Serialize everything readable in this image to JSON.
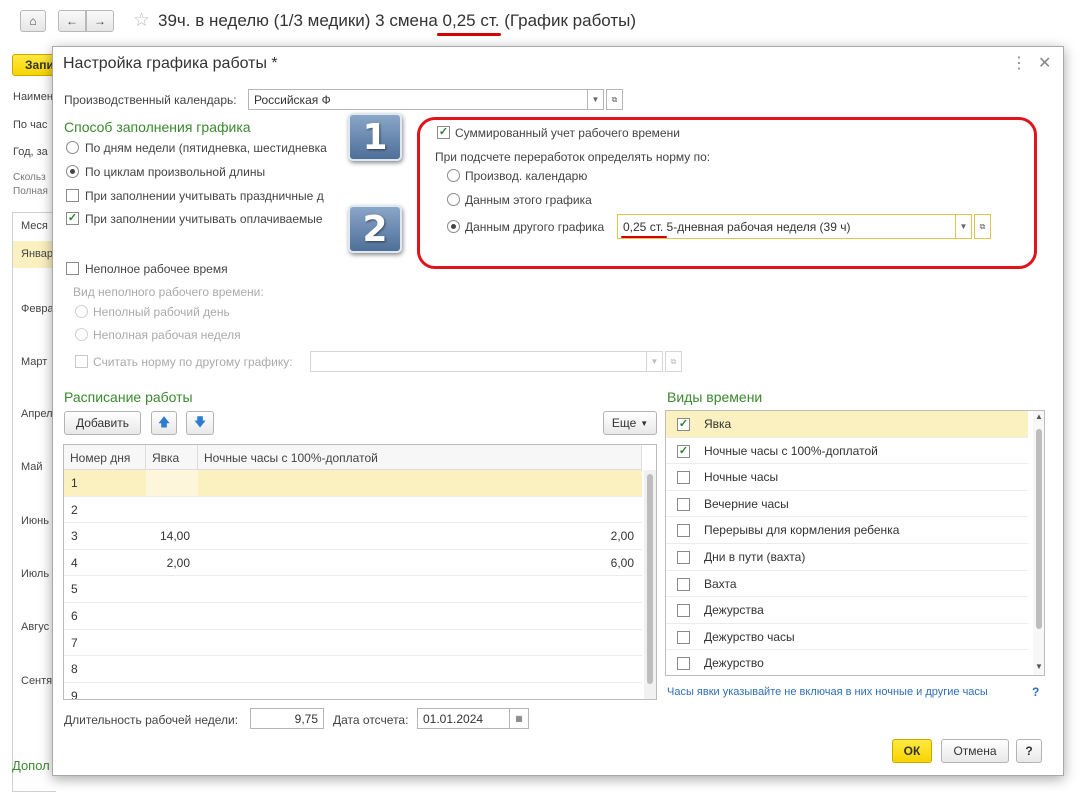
{
  "background": {
    "title": "39ч. в неделю (1/3 медики) 3 смена 0,25 ст. (График работы)",
    "home_icon": "home-icon",
    "back_icon": "arrow-left-icon",
    "forward_icon": "arrow-right-icon",
    "star_icon": "star-icon",
    "write_button": "Запи",
    "side_labels": [
      "Наимен",
      "По час",
      "Год, за",
      "Скольз",
      "Полная"
    ],
    "months_header": "Меся",
    "months": [
      "Январ",
      "Февра",
      "Март",
      "Апрел",
      "Май",
      "Июнь",
      "Июль",
      "Авгус",
      "Сентя"
    ],
    "bottom_label": "Допол"
  },
  "dialog": {
    "title": "Настройка графика работы *",
    "calendar_label": "Производственный календарь:",
    "calendar_value": "Российская Ф",
    "fill_method": {
      "heading": "Способ заполнения графика",
      "option_weekdays": "По дням недели (пятидневка, шестидневка",
      "option_cycles": "По циклам произвольной длины",
      "check_holidays": "При заполнении учитывать праздничные д",
      "check_paid": "При заполнении учитывать оплачиваемые"
    },
    "summed": {
      "check_label": "Суммированный учет рабочего времени",
      "norm_label": "При подсчете переработок определять норму по:",
      "option_calendar": "Производ. календарю",
      "option_this": "Данным этого графика",
      "option_other": "Данным другого графика",
      "other_value": "0,25 ст. 5-дневная рабочая неделя (39 ч)"
    },
    "part_time": {
      "check_label": "Неполное рабочее время",
      "kind_label": "Вид неполного рабочего времени:",
      "option_day": "Неполный рабочий день",
      "option_week": "Неполная рабочая неделя",
      "norm_check": "Считать норму по другому графику:"
    },
    "schedule": {
      "heading": "Расписание работы",
      "add_button": "Добавить",
      "more_button": "Еще",
      "columns": [
        "Номер дня",
        "Явка",
        "Ночные часы с 100%-доплатой"
      ],
      "rows": [
        {
          "day": "1",
          "presence": "",
          "night": ""
        },
        {
          "day": "2",
          "presence": "",
          "night": ""
        },
        {
          "day": "3",
          "presence": "14,00",
          "night": "2,00"
        },
        {
          "day": "4",
          "presence": "2,00",
          "night": "6,00"
        },
        {
          "day": "5",
          "presence": "",
          "night": ""
        },
        {
          "day": "6",
          "presence": "",
          "night": ""
        },
        {
          "day": "7",
          "presence": "",
          "night": ""
        },
        {
          "day": "8",
          "presence": "",
          "night": ""
        },
        {
          "day": "9",
          "presence": "",
          "night": ""
        }
      ]
    },
    "time_types": {
      "heading": "Виды времени",
      "items": [
        {
          "label": "Явка",
          "checked": true
        },
        {
          "label": "Ночные часы с 100%-доплатой",
          "checked": true
        },
        {
          "label": "Ночные часы",
          "checked": false
        },
        {
          "label": "Вечерние часы",
          "checked": false
        },
        {
          "label": "Перерывы для кормления ребенка",
          "checked": false
        },
        {
          "label": "Дни в пути (вахта)",
          "checked": false
        },
        {
          "label": "Вахта",
          "checked": false
        },
        {
          "label": "Дежурства",
          "checked": false
        },
        {
          "label": "Дежурство часы",
          "checked": false
        },
        {
          "label": "Дежурство",
          "checked": false
        }
      ],
      "hint": "Часы явки указывайте не включая в них ночные и другие часы",
      "help": "?"
    },
    "week_length_label": "Длительность рабочей недели:",
    "week_length_value": "9,75",
    "start_date_label": "Дата отсчета:",
    "start_date_value": "01.01.2024",
    "ok_button": "ОК",
    "cancel_button": "Отмена",
    "help_button": "?"
  },
  "annotations": {
    "badge_1": "1",
    "badge_2": "2",
    "highlight_color": "#e0141a"
  }
}
